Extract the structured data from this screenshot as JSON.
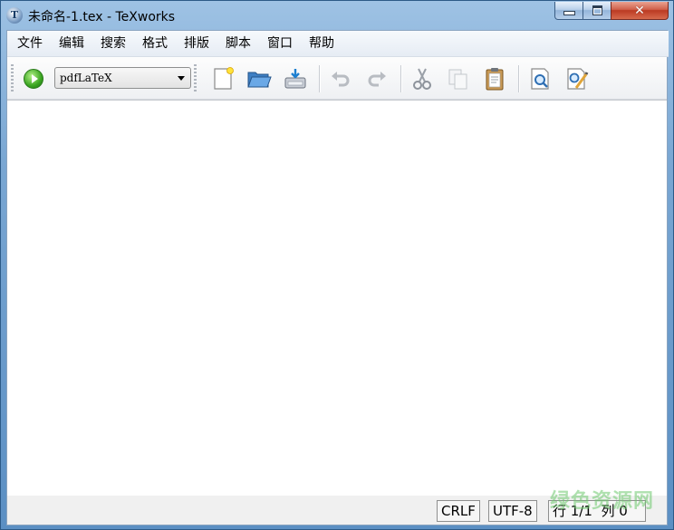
{
  "window": {
    "title": "未命名-1.tex - TeXworks",
    "app_icon_letter": "T",
    "controls": {
      "close_glyph": "✕"
    }
  },
  "menubar": {
    "items": [
      "文件",
      "编辑",
      "搜索",
      "格式",
      "排版",
      "脚本",
      "窗口",
      "帮助"
    ]
  },
  "toolbar": {
    "typeset_engine": "pdfLaTeX",
    "icons": [
      "typeset-run-icon",
      "new-document-icon",
      "open-folder-icon",
      "save-icon",
      "undo-icon",
      "redo-icon",
      "cut-icon",
      "copy-icon",
      "paste-icon",
      "find-icon",
      "replace-icon"
    ]
  },
  "editor": {
    "content": ""
  },
  "statusbar": {
    "line_ending": "CRLF",
    "encoding": "UTF-8",
    "position": "行 1/1  列 0"
  },
  "watermark": {
    "text": "绿色资源网"
  },
  "colors": {
    "titlebar": "#7aa7d3",
    "close_button": "#c8462d",
    "run_button": "#3aa521",
    "watermark": "#6ec86e"
  }
}
